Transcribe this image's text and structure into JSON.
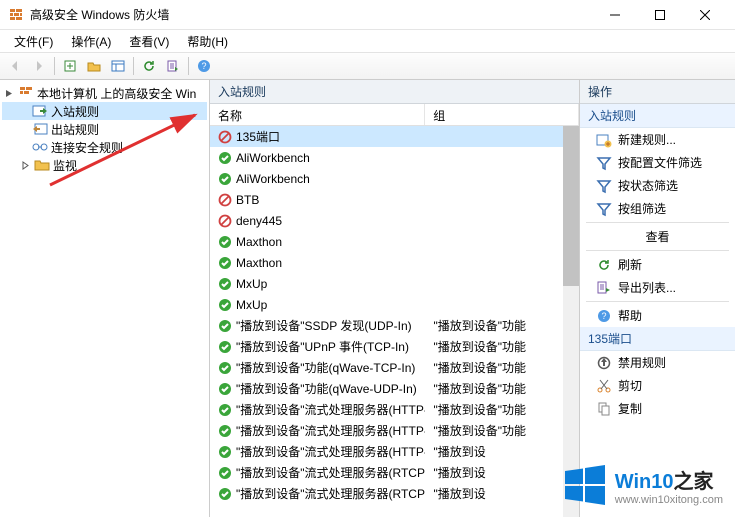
{
  "window": {
    "title": "高级安全 Windows 防火墙"
  },
  "menu": {
    "file": "文件(F)",
    "action": "操作(A)",
    "view": "查看(V)",
    "help": "帮助(H)"
  },
  "tree": {
    "root": "本地计算机 上的高级安全 Win",
    "inbound": "入站规则",
    "outbound": "出站规则",
    "connection": "连接安全规则",
    "monitor": "监视"
  },
  "center": {
    "header": "入站规则",
    "col_name": "名称",
    "col_group": "组"
  },
  "rules": [
    {
      "status": "blocked",
      "name": "135端口",
      "group": "",
      "sel": true
    },
    {
      "status": "ok",
      "name": "AliWorkbench",
      "group": ""
    },
    {
      "status": "ok",
      "name": "AliWorkbench",
      "group": ""
    },
    {
      "status": "blocked",
      "name": "BTB",
      "group": ""
    },
    {
      "status": "blocked",
      "name": "deny445",
      "group": ""
    },
    {
      "status": "ok",
      "name": "Maxthon",
      "group": ""
    },
    {
      "status": "ok",
      "name": "Maxthon",
      "group": ""
    },
    {
      "status": "ok",
      "name": "MxUp",
      "group": ""
    },
    {
      "status": "ok",
      "name": "MxUp",
      "group": ""
    },
    {
      "status": "ok",
      "name": "\"播放到设备\"SSDP 发现(UDP-In)",
      "group": "\"播放到设备\"功能"
    },
    {
      "status": "ok",
      "name": "\"播放到设备\"UPnP 事件(TCP-In)",
      "group": "\"播放到设备\"功能"
    },
    {
      "status": "ok",
      "name": "\"播放到设备\"功能(qWave-TCP-In)",
      "group": "\"播放到设备\"功能"
    },
    {
      "status": "ok",
      "name": "\"播放到设备\"功能(qWave-UDP-In)",
      "group": "\"播放到设备\"功能"
    },
    {
      "status": "ok",
      "name": "\"播放到设备\"流式处理服务器(HTTP-Stre...",
      "group": "\"播放到设备\"功能"
    },
    {
      "status": "ok",
      "name": "\"播放到设备\"流式处理服务器(HTTP-Stre...",
      "group": "\"播放到设备\"功能"
    },
    {
      "status": "ok",
      "name": "\"播放到设备\"流式处理服务器(HTTP-Stre...",
      "group": "\"播放到设"
    },
    {
      "status": "ok",
      "name": "\"播放到设备\"流式处理服务器(RTCP-Stre...",
      "group": "\"播放到设"
    },
    {
      "status": "ok",
      "name": "\"播放到设备\"流式处理服务器(RTCP-Stre...",
      "group": "\"播放到设"
    }
  ],
  "actions": {
    "header": "操作",
    "section1": "入站规则",
    "new_rule": "新建规则...",
    "filter_profile": "按配置文件筛选",
    "filter_state": "按状态筛选",
    "filter_group": "按组筛选",
    "view": "查看",
    "refresh": "刷新",
    "export": "导出列表...",
    "help": "帮助",
    "section2": "135端口",
    "disable": "禁用规则",
    "cut": "剪切",
    "copy": "复制"
  },
  "watermark": {
    "brand_pre": "Win10",
    "brand_post": "之家",
    "url": "www.win10xitong.com"
  }
}
